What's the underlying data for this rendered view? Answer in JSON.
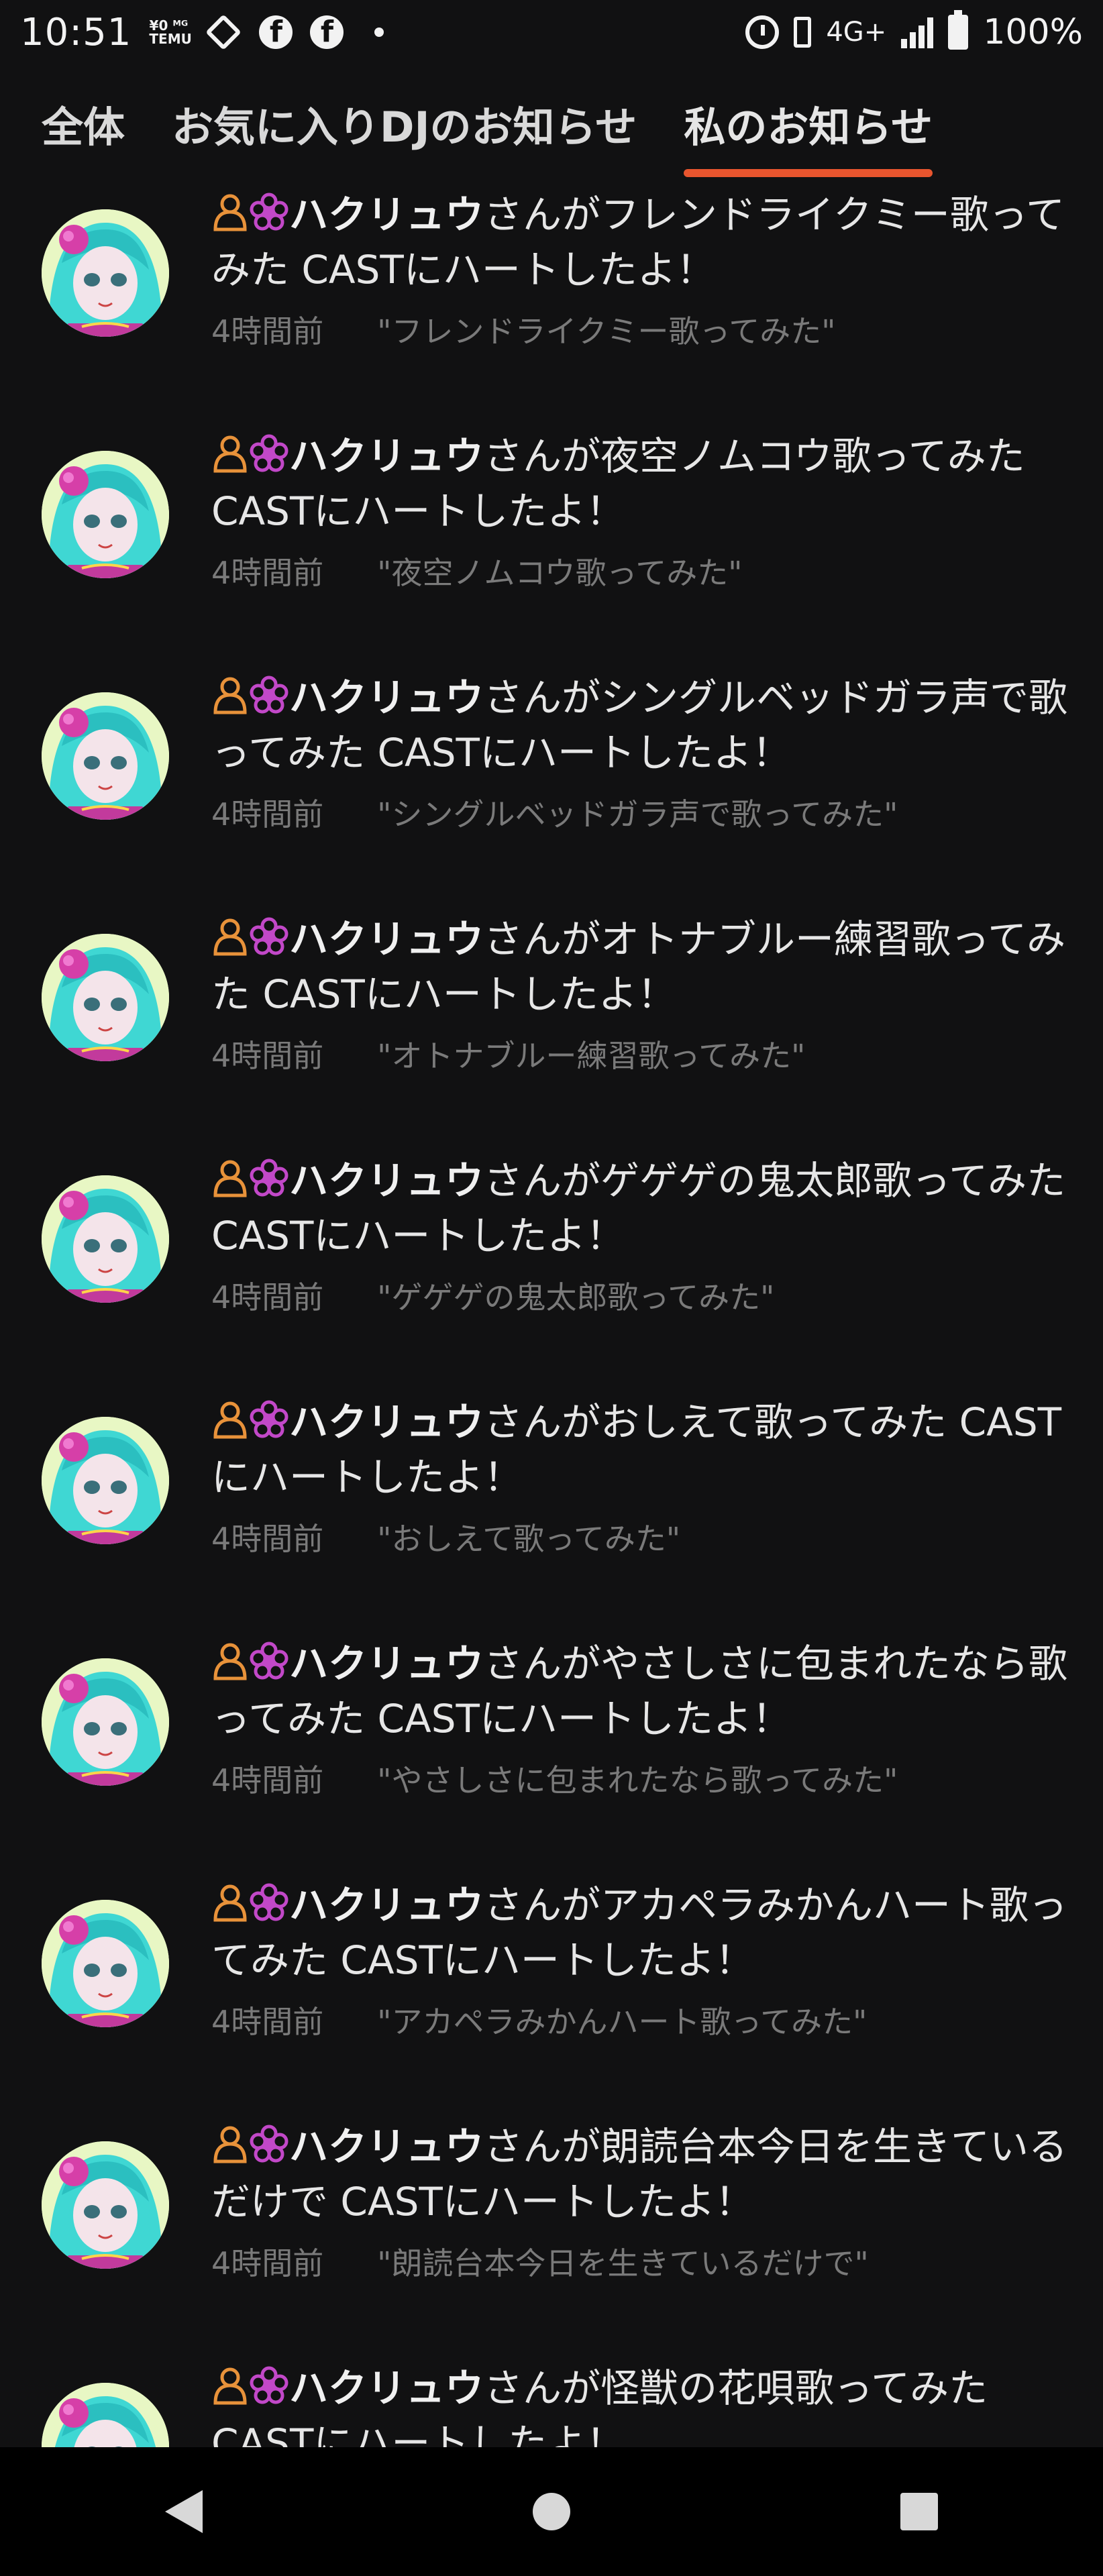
{
  "status_bar": {
    "time": "10:51",
    "temu_line1": "¥0 ᴹᴳ",
    "temu_line2": "TEMU",
    "network": "4G+",
    "battery": "100%",
    "icons": [
      "diamond-icon",
      "facebook-icon",
      "facebook-icon",
      "dot-icon",
      "alarm-icon",
      "vibrate-icon",
      "signal-icon",
      "battery-icon"
    ]
  },
  "tabs": [
    {
      "label": "全体",
      "active": false
    },
    {
      "label": "お気に入りDJのお知らせ",
      "active": false
    },
    {
      "label": "私のお知らせ",
      "active": true
    }
  ],
  "accent_color": "#e8552e",
  "notifications": [
    {
      "user": "ハクリュウ",
      "text": "さんがフレンドライクミー歌ってみた CASTにハートしたよ！",
      "time": "4時間前",
      "cast": "\"フレンドライクミー歌ってみた\""
    },
    {
      "user": "ハクリュウ",
      "text": "さんが夜空ノムコウ歌ってみた CASTにハートしたよ！",
      "time": "4時間前",
      "cast": "\"夜空ノムコウ歌ってみた\""
    },
    {
      "user": "ハクリュウ",
      "text": "さんがシングルベッドガラ声で歌ってみた CASTにハートしたよ！",
      "time": "4時間前",
      "cast": "\"シングルベッドガラ声で歌ってみた\""
    },
    {
      "user": "ハクリュウ",
      "text": "さんがオトナブルー練習歌ってみた CASTにハートしたよ！",
      "time": "4時間前",
      "cast": "\"オトナブルー練習歌ってみた\""
    },
    {
      "user": "ハクリュウ",
      "text": "さんがゲゲゲの鬼太郎歌ってみた CASTにハートしたよ！",
      "time": "4時間前",
      "cast": "\"ゲゲゲの鬼太郎歌ってみた\""
    },
    {
      "user": "ハクリュウ",
      "text": "さんがおしえて歌ってみた CASTにハートしたよ！",
      "time": "4時間前",
      "cast": "\"おしえて歌ってみた\""
    },
    {
      "user": "ハクリュウ",
      "text": "さんがやさしさに包まれたなら歌ってみた CASTにハートしたよ！",
      "time": "4時間前",
      "cast": "\"やさしさに包まれたなら歌ってみた\""
    },
    {
      "user": "ハクリュウ",
      "text": "さんがアカペラみかんハート歌ってみた CASTにハートしたよ！",
      "time": "4時間前",
      "cast": "\"アカペラみかんハート歌ってみた\""
    },
    {
      "user": "ハクリュウ",
      "text": "さんが朗読台本今日を生きているだけで CASTにハートしたよ！",
      "time": "4時間前",
      "cast": "\"朗読台本今日を生きているだけで\""
    },
    {
      "user": "ハクリュウ",
      "text": "さんが怪獣の花唄歌ってみた CASTにハートしたよ！",
      "time": "",
      "cast": ""
    }
  ],
  "nav": {
    "icons": [
      "back-icon",
      "home-icon",
      "recents-icon"
    ]
  }
}
